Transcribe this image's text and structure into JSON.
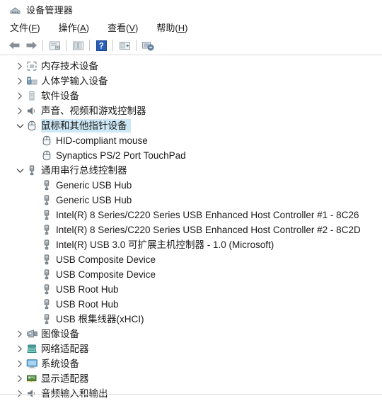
{
  "window": {
    "title": "设备管理器",
    "icon": "device-manager-icon"
  },
  "menubar": {
    "items": [
      {
        "label": "文件(F)",
        "text": "文件(",
        "mnemonic": "F",
        "tail": ")"
      },
      {
        "label": "操作(A)",
        "text": "操作(",
        "mnemonic": "A",
        "tail": ")"
      },
      {
        "label": "查看(V)",
        "text": "查看(",
        "mnemonic": "V",
        "tail": ")"
      },
      {
        "label": "帮助(H)",
        "text": "帮助(",
        "mnemonic": "H",
        "tail": ")"
      }
    ]
  },
  "toolbar": {
    "buttons": [
      {
        "name": "back-arrow-icon",
        "tooltip": "后退"
      },
      {
        "name": "forward-arrow-icon",
        "tooltip": "前进"
      },
      {
        "name": "properties-icon",
        "tooltip": "属性"
      },
      {
        "name": "scan-hardware-changes-icon",
        "tooltip": "扫描检测硬件改动"
      },
      {
        "name": "help-icon",
        "tooltip": "帮助",
        "glyph": "?"
      },
      {
        "name": "update-driver-icon",
        "tooltip": "更新驱动程序"
      },
      {
        "name": "disable-device-icon",
        "tooltip": "禁用设备"
      }
    ]
  },
  "tree": {
    "nodes": [
      {
        "label": "内存技术设备",
        "level": 0,
        "state": "collapsed",
        "icon": "memory-technology-icon",
        "selected": false
      },
      {
        "label": "人体学输入设备",
        "level": 0,
        "state": "collapsed",
        "icon": "hid-input-icon",
        "selected": false
      },
      {
        "label": "软件设备",
        "level": 0,
        "state": "collapsed",
        "icon": "software-device-icon",
        "selected": false
      },
      {
        "label": "声音、视频和游戏控制器",
        "level": 0,
        "state": "collapsed",
        "icon": "speaker-icon",
        "selected": false
      },
      {
        "label": "鼠标和其他指针设备",
        "level": 0,
        "state": "expanded",
        "icon": "mouse-icon",
        "selected": true
      },
      {
        "label": "HID-compliant mouse",
        "level": 1,
        "state": "leaf",
        "icon": "mouse-icon",
        "selected": false
      },
      {
        "label": "Synaptics PS/2 Port TouchPad",
        "level": 1,
        "state": "leaf",
        "icon": "mouse-icon",
        "selected": false
      },
      {
        "label": "通用串行总线控制器",
        "level": 0,
        "state": "expanded",
        "icon": "usb-icon",
        "selected": false
      },
      {
        "label": "Generic USB Hub",
        "level": 1,
        "state": "leaf",
        "icon": "usb-icon",
        "selected": false
      },
      {
        "label": "Generic USB Hub",
        "level": 1,
        "state": "leaf",
        "icon": "usb-icon",
        "selected": false
      },
      {
        "label": "Intel(R) 8 Series/C220 Series USB Enhanced Host Controller #1 - 8C26",
        "level": 1,
        "state": "leaf",
        "icon": "usb-icon",
        "selected": false
      },
      {
        "label": "Intel(R) 8 Series/C220 Series USB Enhanced Host Controller #2 - 8C2D",
        "level": 1,
        "state": "leaf",
        "icon": "usb-icon",
        "selected": false
      },
      {
        "label": "Intel(R) USB 3.0 可扩展主机控制器 - 1.0 (Microsoft)",
        "level": 1,
        "state": "leaf",
        "icon": "usb-icon",
        "selected": false
      },
      {
        "label": "USB Composite Device",
        "level": 1,
        "state": "leaf",
        "icon": "usb-icon",
        "selected": false
      },
      {
        "label": "USB Composite Device",
        "level": 1,
        "state": "leaf",
        "icon": "usb-icon",
        "selected": false
      },
      {
        "label": "USB Root Hub",
        "level": 1,
        "state": "leaf",
        "icon": "usb-icon",
        "selected": false
      },
      {
        "label": "USB Root Hub",
        "level": 1,
        "state": "leaf",
        "icon": "usb-icon",
        "selected": false
      },
      {
        "label": "USB 根集线器(xHCI)",
        "level": 1,
        "state": "leaf",
        "icon": "usb-icon",
        "selected": false
      },
      {
        "label": "图像设备",
        "level": 0,
        "state": "collapsed",
        "icon": "camera-icon",
        "selected": false
      },
      {
        "label": "网络适配器",
        "level": 0,
        "state": "collapsed",
        "icon": "network-adapter-icon",
        "selected": false
      },
      {
        "label": "系统设备",
        "level": 0,
        "state": "collapsed",
        "icon": "monitor-icon",
        "selected": false
      },
      {
        "label": "显示适配器",
        "level": 0,
        "state": "collapsed",
        "icon": "display-adapter-icon",
        "selected": false
      },
      {
        "label": "音频输入和输出",
        "level": 0,
        "state": "collapsed",
        "icon": "speaker-icon",
        "selected": false
      }
    ]
  },
  "colors": {
    "selection": "#cde8f6",
    "help_blue": "#2a5fb8",
    "arrow_gray": "#707070",
    "text": "#1a1a1a",
    "network_teal": "#4aa8a0",
    "monitor_blue": "#6aaede",
    "adapter_green": "#5a9e4a"
  }
}
